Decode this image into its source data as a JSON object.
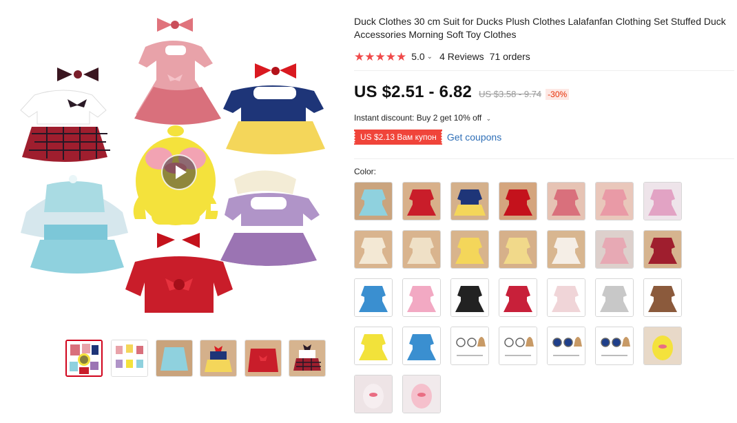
{
  "product": {
    "title": "Duck Clothes 30 cm Suit for Ducks Plush Clothes Lalafanfan Clothing Set Stuffed Duck Accessories Morning Soft Toy Clothes",
    "rating": "5.0",
    "rating_chevron": "⌄",
    "reviews": "4 Reviews",
    "orders": "71 orders",
    "stars": "★★★★★",
    "star_color": "#f04a4a"
  },
  "price": {
    "current": "US $2.51 - 6.82",
    "original": "US $3.58 - 9.74",
    "discount": "-30%"
  },
  "promo": {
    "instant_discount": "Instant discount: Buy 2 get 10% off",
    "coupon_badge": "US $2.13 Вам купон",
    "get_coupons": "Get coupons",
    "accent_color": "#f0443a",
    "link_color": "#2f6fb7"
  },
  "gallery": {
    "play_icon": "play-icon",
    "thumbnails": [
      {
        "name": "thumb-1-video-collage",
        "active": true
      },
      {
        "name": "thumb-2-collage"
      },
      {
        "name": "thumb-3-blue-dress"
      },
      {
        "name": "thumb-4-snow-white"
      },
      {
        "name": "thumb-5-red-kimono"
      },
      {
        "name": "thumb-6-plaid-outfit"
      }
    ]
  },
  "color": {
    "label": "Color:",
    "options": [
      {
        "kind": "blue-dress"
      },
      {
        "kind": "red-kimono"
      },
      {
        "kind": "snow-white"
      },
      {
        "kind": "red-floral"
      },
      {
        "kind": "pink-floral"
      },
      {
        "kind": "pink-dress"
      },
      {
        "kind": "pink-bow"
      },
      {
        "kind": "cream-dress"
      },
      {
        "kind": "cream-dress-2"
      },
      {
        "kind": "yellow-dress"
      },
      {
        "kind": "yellow-floral"
      },
      {
        "kind": "white-dress"
      },
      {
        "kind": "pink-frill"
      },
      {
        "kind": "plaid"
      },
      {
        "kind": "blue-shirt"
      },
      {
        "kind": "pink-ruffle"
      },
      {
        "kind": "overalls-black"
      },
      {
        "kind": "red-heart"
      },
      {
        "kind": "white-heart"
      },
      {
        "kind": "grey-heart"
      },
      {
        "kind": "brown-overalls"
      },
      {
        "kind": "yellow-shirt"
      },
      {
        "kind": "blue-shirt-hat"
      },
      {
        "kind": "glasses-set-1"
      },
      {
        "kind": "glasses-set-2"
      },
      {
        "kind": "glasses-set-3"
      },
      {
        "kind": "glasses-set-4"
      },
      {
        "kind": "duck-yellow"
      },
      {
        "kind": "duck-white"
      },
      {
        "kind": "duck-pink"
      }
    ]
  }
}
